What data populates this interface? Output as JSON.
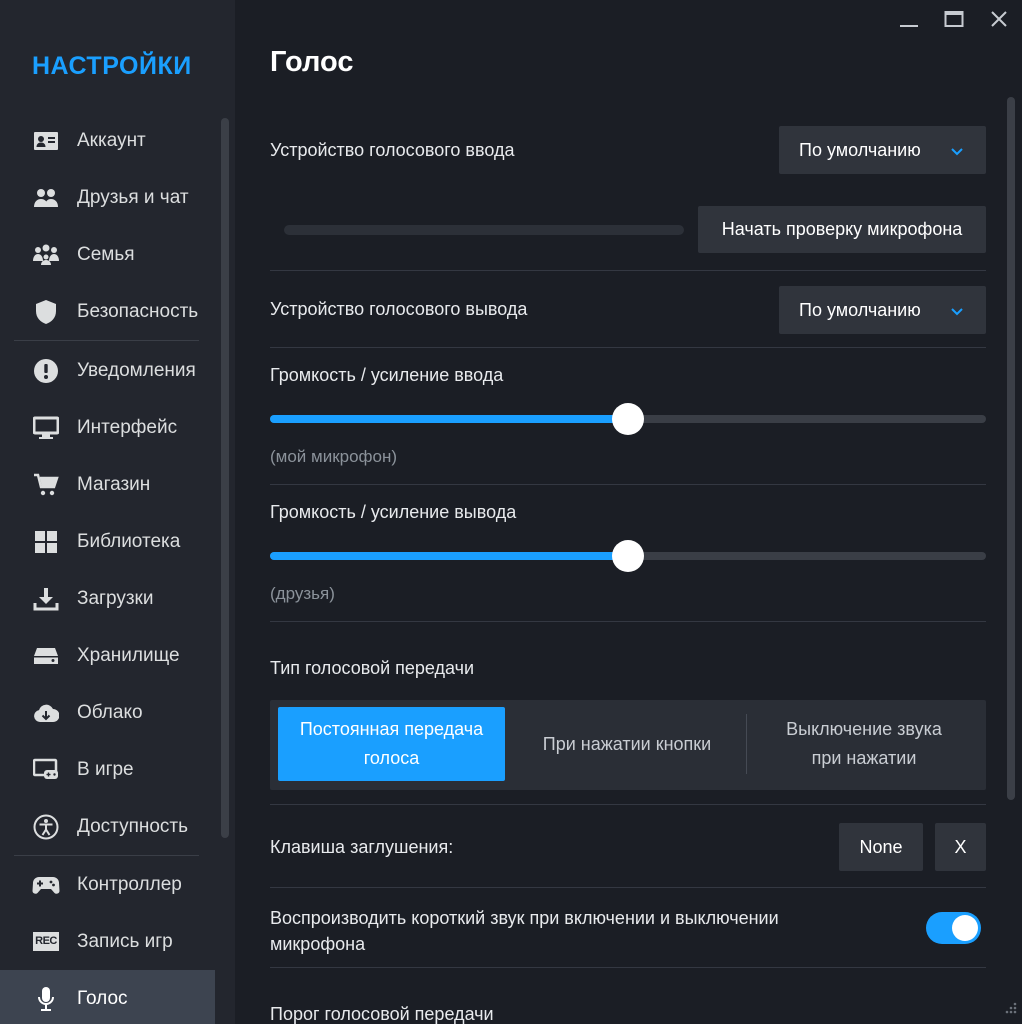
{
  "colors": {
    "accent": "#1a9fff",
    "sidebar_bg": "#23262e",
    "main_bg": "#1b1e25"
  },
  "sidebar": {
    "title": "НАСТРОЙКИ",
    "items": [
      {
        "label": "Аккаунт",
        "icon": "id-card-icon"
      },
      {
        "label": "Друзья и чат",
        "icon": "friends-icon"
      },
      {
        "label": "Семья",
        "icon": "family-icon"
      },
      {
        "label": "Безопасность",
        "icon": "shield-icon"
      },
      {
        "label": "Уведомления",
        "icon": "alert-icon"
      },
      {
        "label": "Интерфейс",
        "icon": "monitor-icon"
      },
      {
        "label": "Магазин",
        "icon": "cart-icon"
      },
      {
        "label": "Библиотека",
        "icon": "grid-icon"
      },
      {
        "label": "Загрузки",
        "icon": "download-icon"
      },
      {
        "label": "Хранилище",
        "icon": "storage-icon"
      },
      {
        "label": "Облако",
        "icon": "cloud-icon"
      },
      {
        "label": "В игре",
        "icon": "in-game-icon"
      },
      {
        "label": "Доступность",
        "icon": "accessibility-icon"
      },
      {
        "label": "Контроллер",
        "icon": "gamepad-icon"
      },
      {
        "label": "Запись игр",
        "icon": "rec-icon",
        "icon_text": "REC"
      },
      {
        "label": "Голос",
        "icon": "microphone-icon",
        "active": true
      }
    ]
  },
  "main": {
    "title": "Голос",
    "input_device": {
      "label": "Устройство голосового ввода",
      "value": "По умолчанию"
    },
    "mic_test_button": "Начать проверку микрофона",
    "output_device": {
      "label": "Устройство голосового вывода",
      "value": "По умолчанию"
    },
    "input_volume": {
      "label": "Громкость / усиление ввода",
      "sublabel": "(мой микрофон)",
      "level": 0.5
    },
    "output_volume": {
      "label": "Громкость / усиление вывода",
      "sublabel": "(друзья)",
      "level": 0.5
    },
    "transmission": {
      "label": "Тип голосовой передачи",
      "options": [
        {
          "line1": "Постоянная передача",
          "line2": "голоса",
          "active": true
        },
        {
          "line1": "При нажатии кнопки",
          "line2": ""
        },
        {
          "line1": "Выключение звука",
          "line2": "при нажатии"
        }
      ]
    },
    "mute_key": {
      "label": "Клавиша заглушения:",
      "value": "None",
      "clear": "X"
    },
    "play_sound": {
      "line1": "Воспроизводить короткий звук при включении и выключении",
      "line2": "микрофона",
      "enabled": true
    },
    "threshold_label": "Порог голосовой передачи"
  }
}
